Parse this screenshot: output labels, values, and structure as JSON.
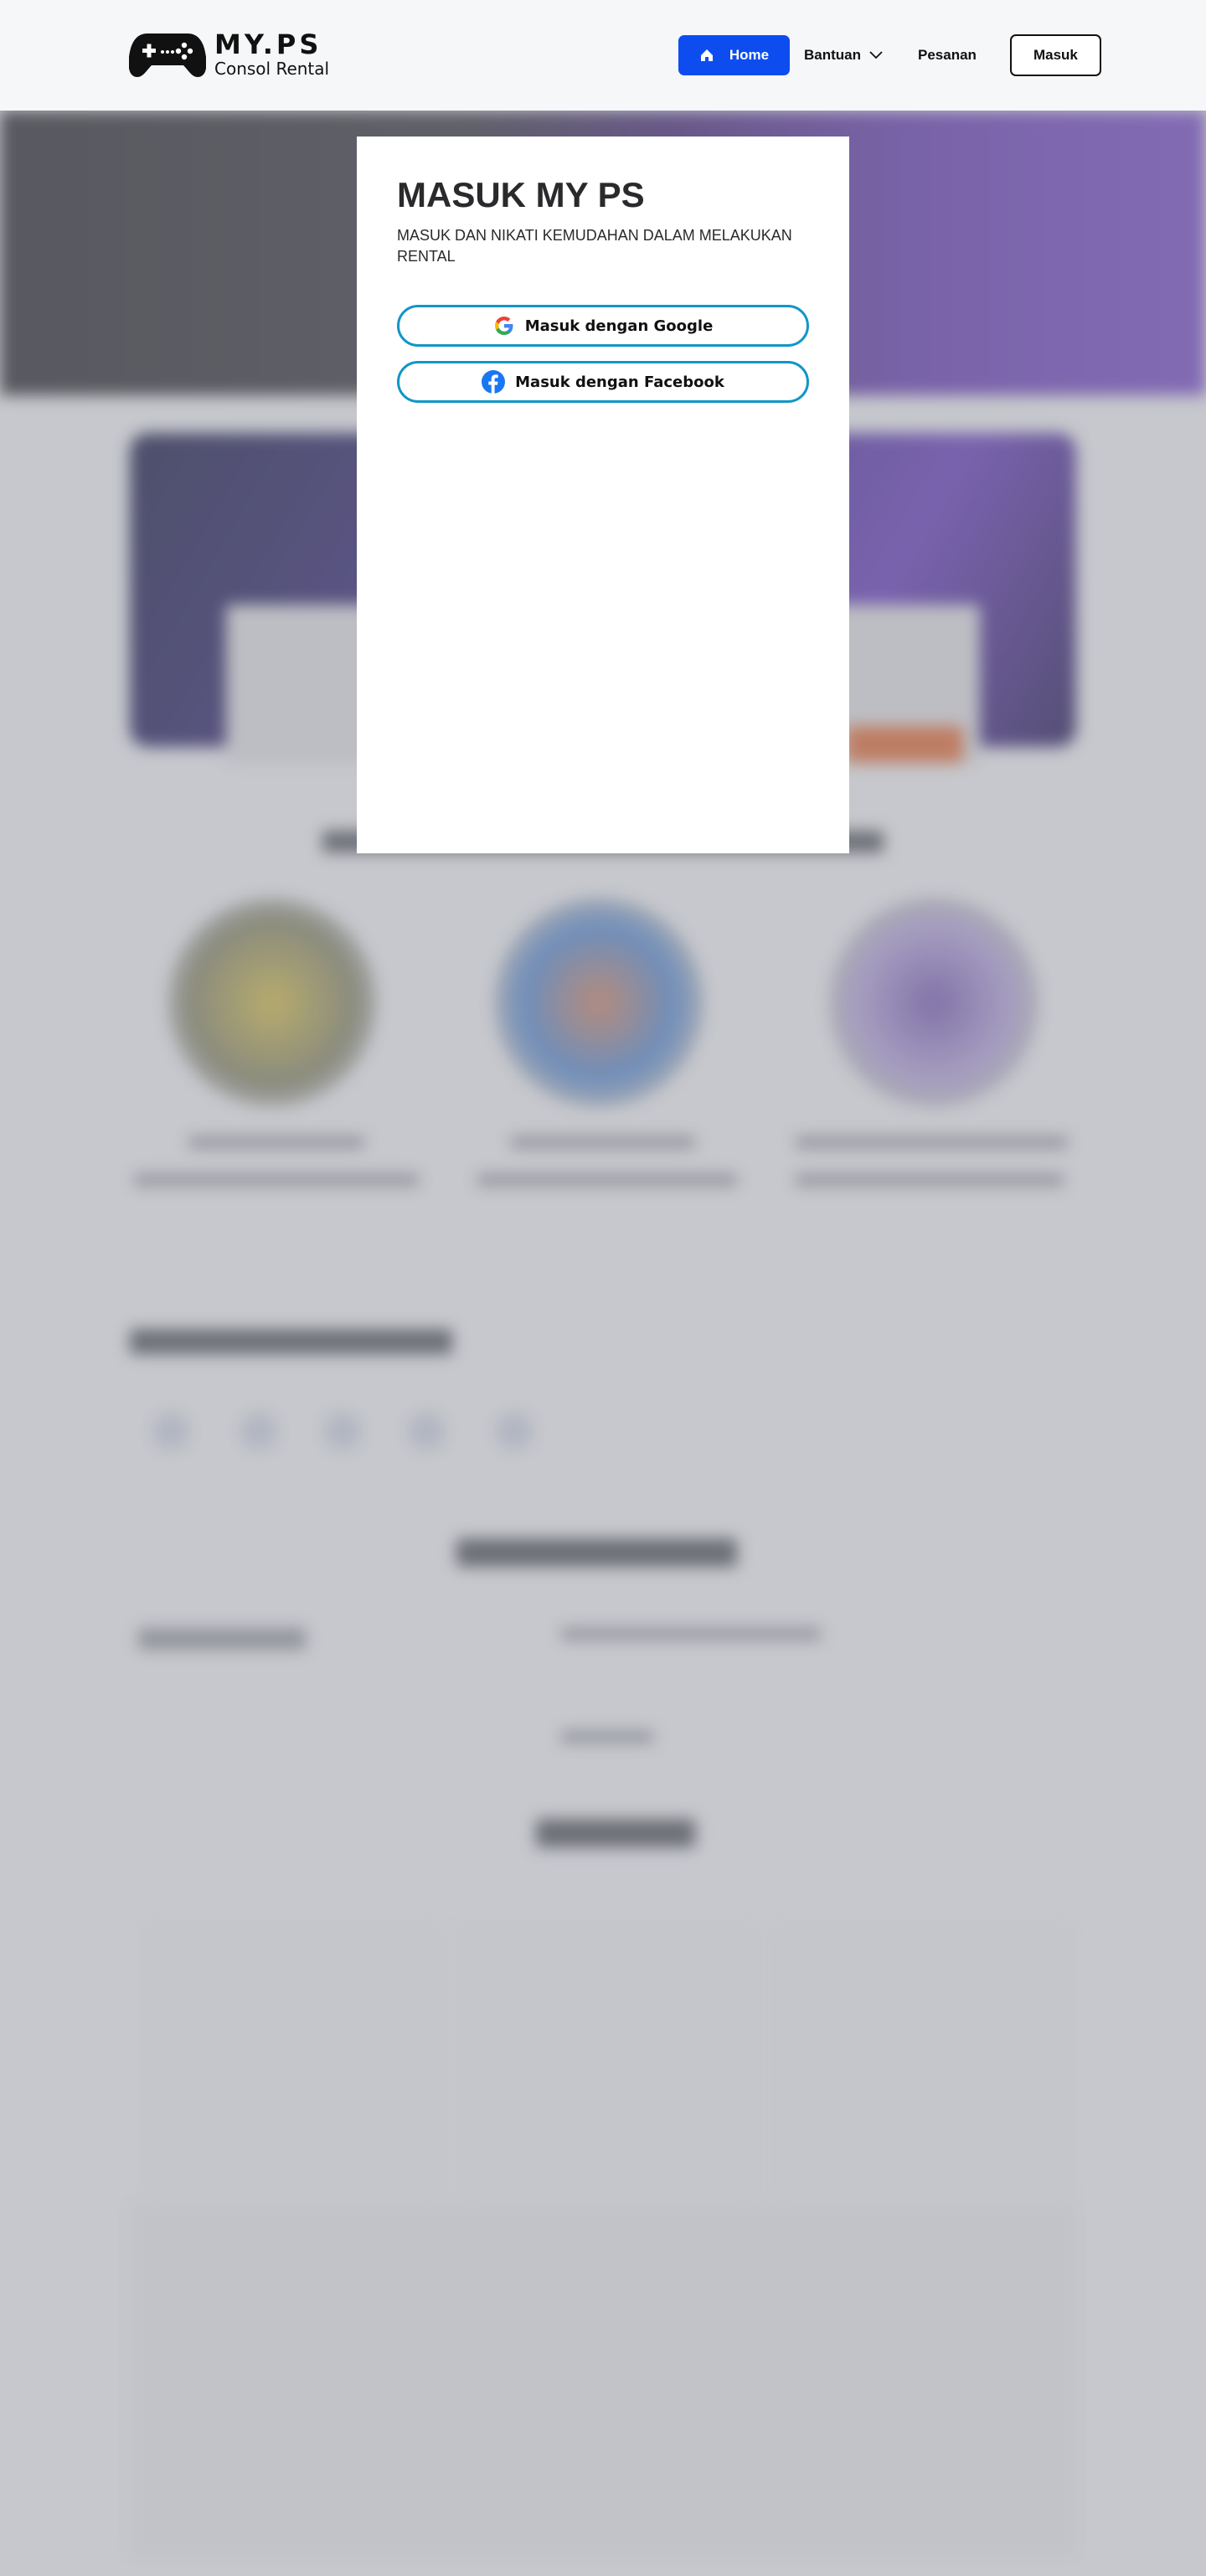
{
  "header": {
    "logo_title": "MY.PS",
    "logo_subtitle": "Consol Rental",
    "nav": {
      "home": "Home",
      "bantuan": "Bantuan",
      "pesanan": "Pesanan",
      "masuk": "Masuk"
    }
  },
  "modal": {
    "title": "MASUK MY PS",
    "subtitle": "MASUK DAN NIKATI KEMUDAHAN DALAM MELAKUKAN RENTAL",
    "google_button": "Masuk dengan Google",
    "facebook_button": "Masuk dengan Facebook"
  },
  "colors": {
    "primary": "#0d4df0",
    "social_border": "#1196c9",
    "facebook": "#1877f2"
  },
  "icons": [
    "gamepad-logo-icon",
    "home-icon",
    "chevron-down-icon",
    "google-icon",
    "facebook-icon"
  ]
}
